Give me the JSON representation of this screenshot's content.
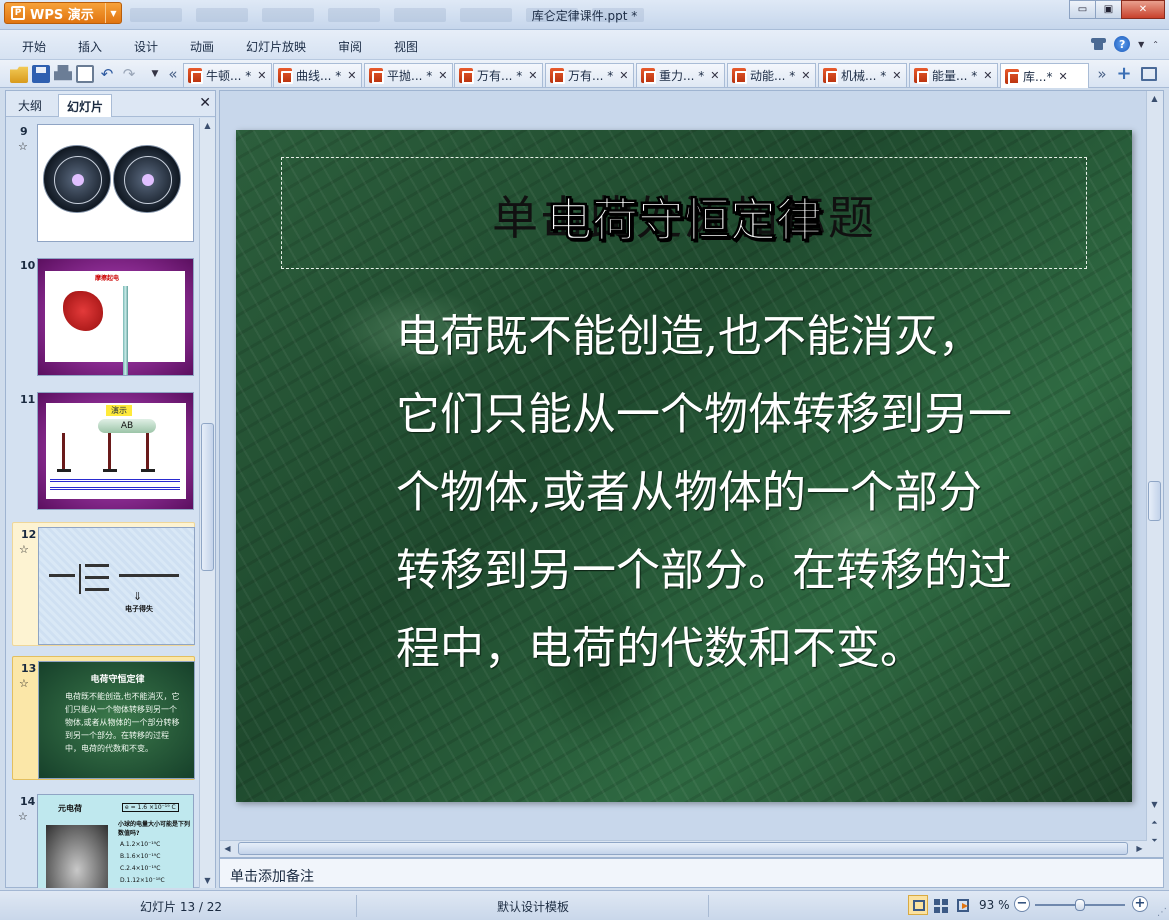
{
  "app": {
    "logo_text": "WPS 演示",
    "window_title": "库仑定律课件.ppt *"
  },
  "window_buttons": {
    "minimize": "▭",
    "restore": "▣",
    "close": "✕"
  },
  "menu": [
    "开始",
    "插入",
    "设计",
    "动画",
    "幻灯片放映",
    "审阅",
    "视图"
  ],
  "doc_tabs": [
    {
      "label": "牛顿... *",
      "close": "✕"
    },
    {
      "label": "曲线... *",
      "close": "✕"
    },
    {
      "label": "平抛... *",
      "close": "✕"
    },
    {
      "label": "万有... *",
      "close": "✕"
    },
    {
      "label": "万有... *",
      "close": "✕"
    },
    {
      "label": "重力... *",
      "close": "✕"
    },
    {
      "label": "动能... *",
      "close": "✕"
    },
    {
      "label": "机械... *",
      "close": "✕"
    },
    {
      "label": "能量... *",
      "close": "✕"
    },
    {
      "label": "库...*",
      "close": "✕"
    }
  ],
  "left_panel": {
    "tab_outline": "大纲",
    "tab_slides": "幻灯片",
    "close": "✕",
    "slides": [
      {
        "number": "9",
        "star": "☆"
      },
      {
        "number": "10",
        "star": ""
      },
      {
        "number": "11",
        "star": ""
      },
      {
        "number": "12",
        "star": "☆"
      },
      {
        "number": "13",
        "star": "☆"
      },
      {
        "number": "14",
        "star": "☆"
      }
    ],
    "thumb10_title": "摩擦起电",
    "thumb11_tag": "演示",
    "thumb11_ab": "AB",
    "thumb12_text": "电子得失",
    "thumb13_title": "电荷守恒定律",
    "thumb13_body": "电荷既不能创造,也不能消灭，它们只能从一个物体转移到另一个物体,或者从物体的一个部分转移到另一个部分。在转移的过程中，电荷的代数和不变。",
    "thumb14_title": "元电荷",
    "thumb14_formula": "e = 1.6 ×10⁻¹⁹ C",
    "thumb14_q": "小球的电量大小可能是下列数值吗?",
    "thumb14_opts": [
      "A.1.2×10⁻¹⁹C",
      "B.1.6×10⁻¹⁹C",
      "C.2.4×10⁻¹⁹C",
      "D.1.12×10⁻¹⁸C"
    ]
  },
  "slide": {
    "placeholder_title": "单击此处添加标题",
    "title": "电荷守恒定律",
    "body": "电荷既不能创造,也不能消灭，它们只能从一个物体转移到另一个物体,或者从物体的一个部分转移到另一个部分。在转移的过程中，电荷的代数和不变。"
  },
  "notes_placeholder": "单击添加备注",
  "status": {
    "slide_counter": "幻灯片 13 / 22",
    "template": "默认设计模板",
    "zoom": "93 %",
    "zoom_level": 0.5
  }
}
